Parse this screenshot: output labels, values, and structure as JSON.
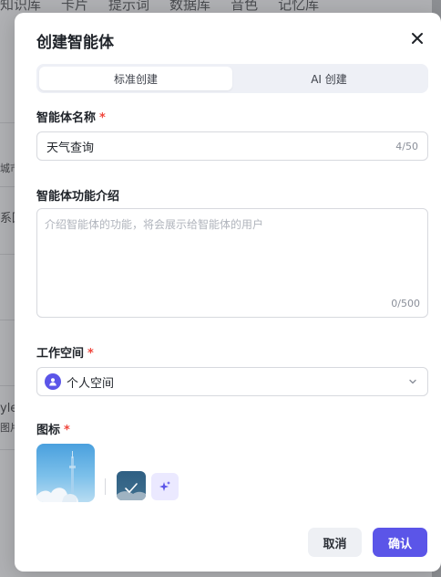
{
  "background": {
    "tabs": [
      "知识库",
      "卡片",
      "提示词",
      "数据库",
      "音色",
      "记忆库"
    ],
    "left_fragments": [
      "城市",
      "系回",
      "yle",
      "图片"
    ]
  },
  "dialog": {
    "title": "创建智能体",
    "close_icon": "close-icon",
    "mode_tabs": [
      {
        "label": "标准创建",
        "active": true
      },
      {
        "label": "AI 创建",
        "active": false
      }
    ],
    "name_field": {
      "label": "智能体名称",
      "required_mark": "*",
      "value": "天气查询",
      "counter": "4/50"
    },
    "description_field": {
      "label": "智能体功能介绍",
      "placeholder": "介绍智能体的功能，将会展示给智能体的用户",
      "counter": "0/500"
    },
    "workspace_field": {
      "label": "工作空间",
      "required_mark": "*",
      "value": "个人空间",
      "icon": "user-icon",
      "dropdown_icon": "chevron-down-icon"
    },
    "icon_field": {
      "label": "图标",
      "required_mark": "*",
      "ai_generate_icon": "sparkle-icon"
    },
    "actions": {
      "cancel": "取消",
      "confirm": "确认"
    },
    "colors": {
      "primary": "#5b55e8",
      "required": "#f0463c",
      "border": "#d7d9de"
    }
  }
}
